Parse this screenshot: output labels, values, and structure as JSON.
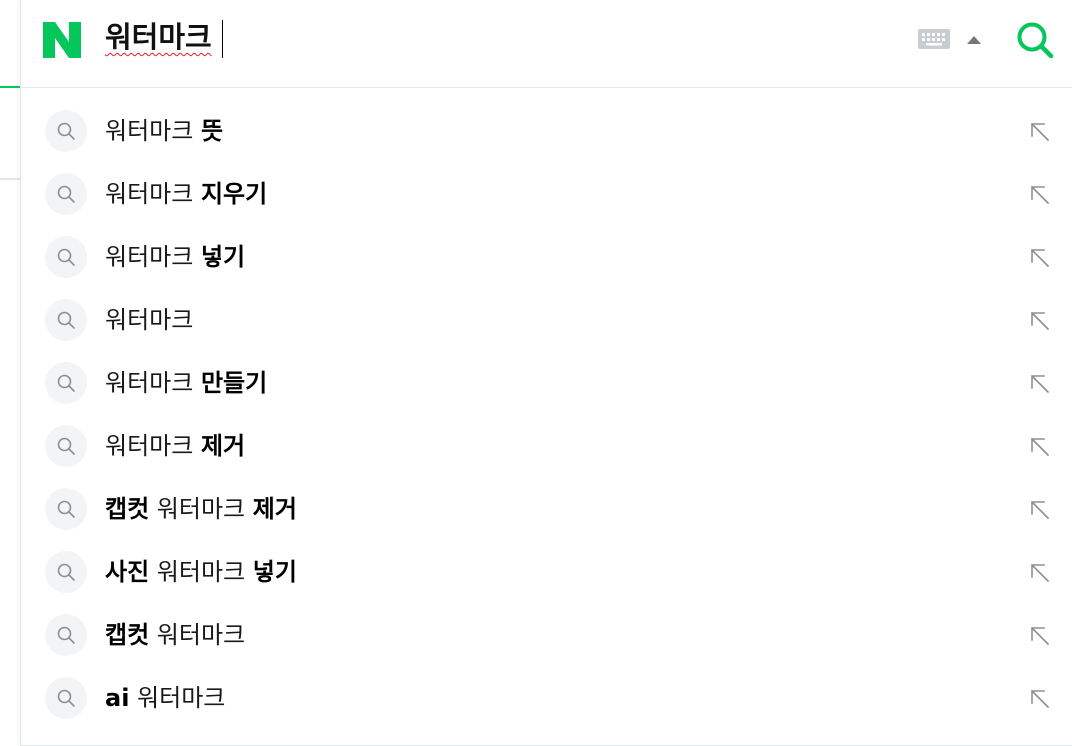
{
  "search": {
    "query": "워터마크"
  },
  "colors": {
    "brand_green": "#03c75a",
    "icon_gray": "#8f8f8f"
  },
  "icons": {
    "logo": "naver-n-logo",
    "keyboard": "keyboard-icon",
    "toggle": "arrow-up-icon",
    "search": "search-icon",
    "suggestion_leading": "magnifier-icon",
    "suggestion_trailing": "fill-query-arrow-icon"
  },
  "suggestions": [
    {
      "parts": [
        {
          "text": "워터마크 ",
          "bold": false
        },
        {
          "text": "뜻",
          "bold": true
        }
      ]
    },
    {
      "parts": [
        {
          "text": "워터마크 ",
          "bold": false
        },
        {
          "text": "지우기",
          "bold": true
        }
      ]
    },
    {
      "parts": [
        {
          "text": "워터마크 ",
          "bold": false
        },
        {
          "text": "넣기",
          "bold": true
        }
      ]
    },
    {
      "parts": [
        {
          "text": "워터마크",
          "bold": false
        }
      ]
    },
    {
      "parts": [
        {
          "text": "워터마크 ",
          "bold": false
        },
        {
          "text": "만들기",
          "bold": true
        }
      ]
    },
    {
      "parts": [
        {
          "text": "워터마크 ",
          "bold": false
        },
        {
          "text": "제거",
          "bold": true
        }
      ]
    },
    {
      "parts": [
        {
          "text": "캡컷",
          "bold": true
        },
        {
          "text": " 워터마크 ",
          "bold": false
        },
        {
          "text": "제거",
          "bold": true
        }
      ]
    },
    {
      "parts": [
        {
          "text": "사진",
          "bold": true
        },
        {
          "text": " 워터마크 ",
          "bold": false
        },
        {
          "text": "넣기",
          "bold": true
        }
      ]
    },
    {
      "parts": [
        {
          "text": "캡컷",
          "bold": true
        },
        {
          "text": " 워터마크",
          "bold": false
        }
      ]
    },
    {
      "parts": [
        {
          "text": "ai",
          "bold": true
        },
        {
          "text": " 워터마크",
          "bold": false
        }
      ]
    }
  ]
}
